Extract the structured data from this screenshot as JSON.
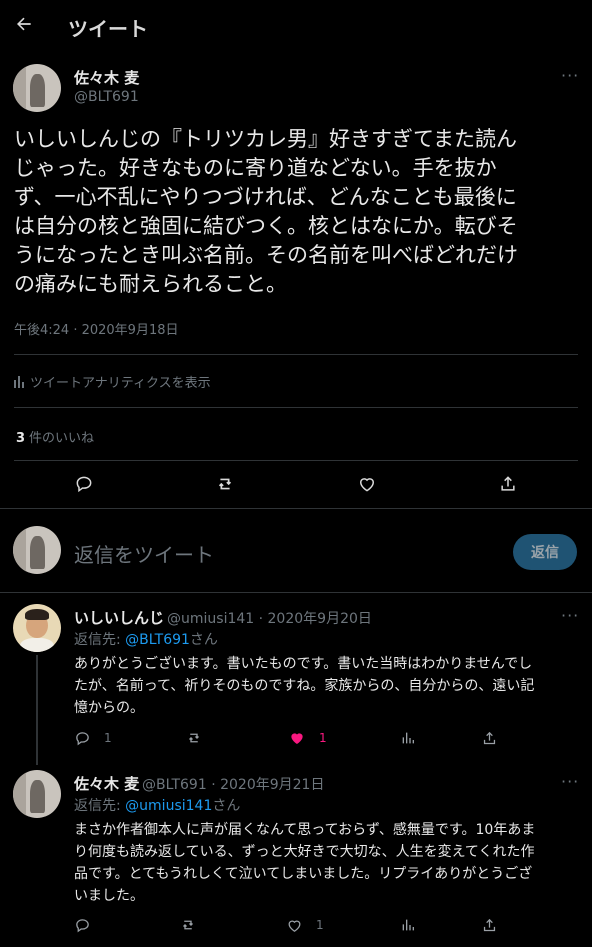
{
  "header": {
    "title": "ツイート"
  },
  "main_tweet": {
    "author_name": "佐々木 麦",
    "author_handle": "@BLT691",
    "lines": [
      "いしいしんじの『トリツカレ男』好きすぎてまた読ん",
      "じゃった。好きなものに寄り道などない。手を抜か",
      "ず、一心不乱にやりつづければ、どんなことも最後に",
      "は自分の核と強固に結びつく。核とはなにか。転びそ",
      "うになったとき叫ぶ名前。その名前を叫べばどれだけ",
      "の痛みにも耐えられること。"
    ],
    "timestamp": "午後4:24 · 2020年9月18日",
    "analytics_label": "ツイートアナリティクスを表示",
    "likes_count": "3",
    "likes_label": "件のいいね"
  },
  "reply_box": {
    "placeholder": "返信をツイート",
    "button_label": "返信"
  },
  "replies": [
    {
      "name": "いしいしんじ",
      "meta": "@umiusi141 · 2020年9月20日",
      "reply_to_prefix": "返信先: ",
      "reply_to_handle": "@BLT691",
      "reply_to_suffix": "さん",
      "lines": [
        "ありがとうございます。書いたものです。書いた当時はわかりませんでし",
        "たが、名前って、祈りそのものですね。家族からの、自分からの、遠い記",
        "憶からの。"
      ],
      "reply_count": "1",
      "like_count": "1"
    },
    {
      "name": "佐々木 麦",
      "meta": "@BLT691 · 2020年9月21日",
      "reply_to_prefix": "返信先: ",
      "reply_to_handle": "@umiusi141",
      "reply_to_suffix": "さん",
      "lines": [
        "まさか作者御本人に声が届くなんて思っておらず、感無量です。10年あま",
        "り何度も読み返している、ずっと大好きで大切な、人生を変えてくれた作",
        "品です。とてもうれしくて泣いてしまいました。リプライありがとうござ",
        "いました。"
      ],
      "like_count": "1"
    }
  ],
  "colors": {
    "background": "#000000",
    "accent": "#1d9bf0",
    "like": "#f91880",
    "muted": "#6e767d"
  },
  "icons": [
    "back-arrow-icon",
    "more-icon",
    "analytics-icon",
    "reply-icon",
    "retweet-icon",
    "heart-icon",
    "share-icon"
  ]
}
